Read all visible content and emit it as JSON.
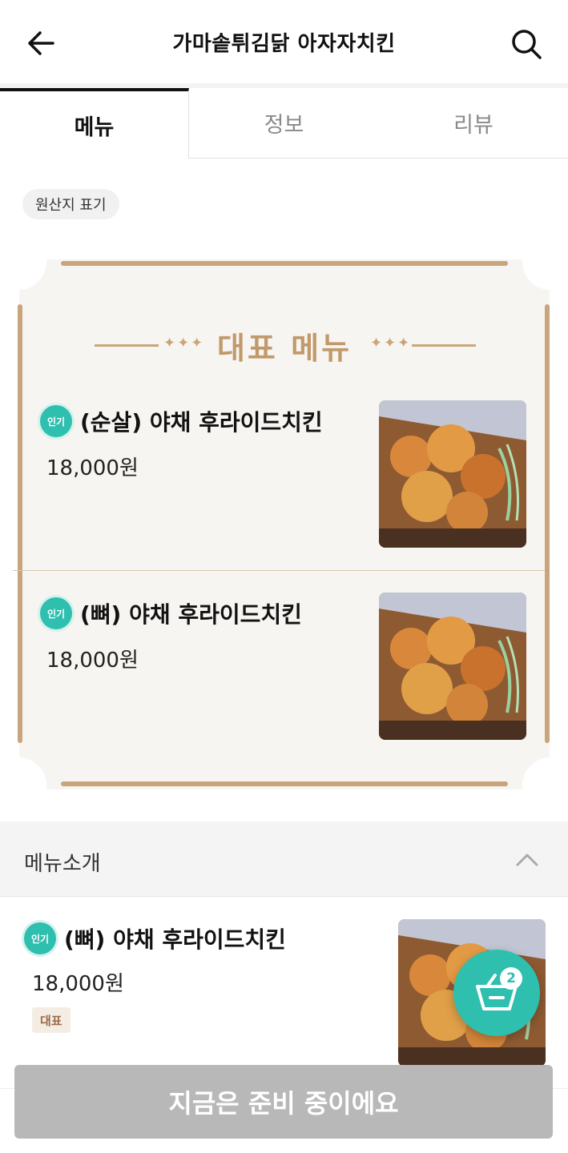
{
  "header": {
    "title": "가마솥튀김닭 아자자치킨",
    "back_icon": "arrow-left-icon",
    "search_icon": "search-icon"
  },
  "tabs": [
    {
      "label": "메뉴",
      "active": true
    },
    {
      "label": "정보",
      "active": false
    },
    {
      "label": "리뷰",
      "active": false
    }
  ],
  "origin_chip": "원산지 표기",
  "featured": {
    "heading": "대표 메뉴",
    "items": [
      {
        "badge": "인기",
        "name": "(순살) 야채 후라이드치킨",
        "price": "18,000원",
        "image": "fried-chicken-photo"
      },
      {
        "badge": "인기",
        "name": "(뼈) 야채 후라이드치킨",
        "price": "18,000원",
        "image": "fried-chicken-photo"
      }
    ]
  },
  "section": {
    "title": "메뉴소개",
    "expanded": true
  },
  "menu_list": [
    {
      "badge": "인기",
      "name": "(뼈) 야채 후라이드치킨",
      "price": "18,000원",
      "tag": "대표",
      "image": "fried-chicken-photo"
    }
  ],
  "cart": {
    "count": "2",
    "icon": "basket-icon"
  },
  "bottom_button": "지금은 준비 중이에요",
  "colors": {
    "accent": "#2fbfae",
    "gold": "#c9a57c",
    "disabled": "#b8b8b8"
  }
}
